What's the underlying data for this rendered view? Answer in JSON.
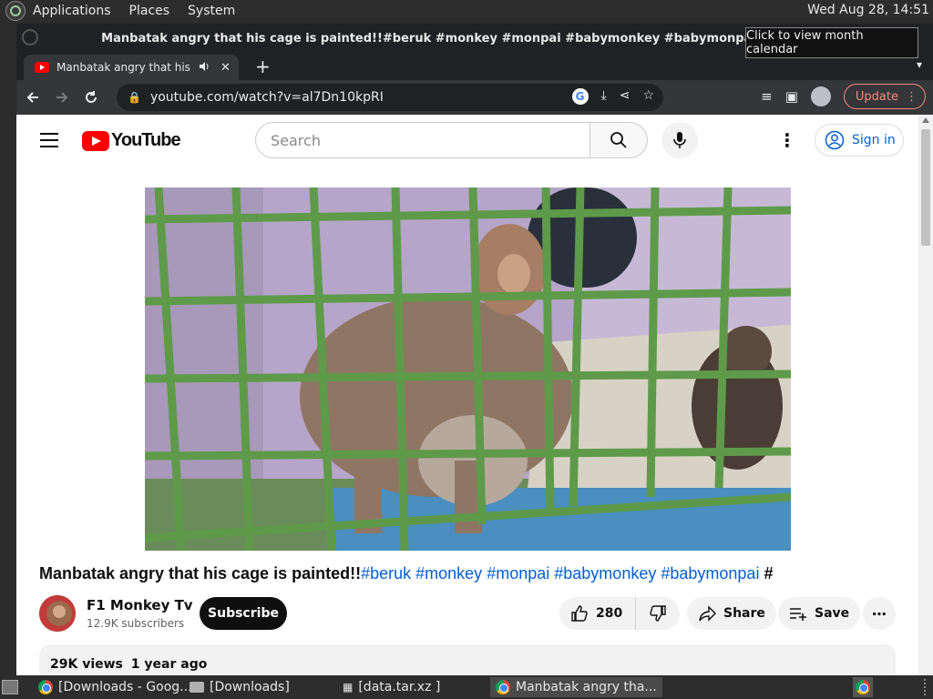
{
  "top_panel": {
    "menus": [
      "Applications",
      "Places",
      "System"
    ],
    "clock": "Wed Aug 28, 14:51"
  },
  "window": {
    "title": "Manbatak angry that his cage is painted!!#beruk #monkey #monpai #babymonkey #babymonpai # - YouTube -"
  },
  "tooltip": "Click to view month calendar",
  "tab": {
    "title": "Manbatak angry that his cage is painted!!#beruk #monkey #monpai #babymonkey #babymonpai #",
    "new_tab": "+"
  },
  "toolbar": {
    "url": "youtube.com/watch?v=al7Dn10kpRI",
    "update_label": "Update"
  },
  "youtube": {
    "logo_text": "YouTube",
    "search_placeholder": "Search",
    "sign_in": "Sign in"
  },
  "video": {
    "title_main": "Manbatak angry that his cage is painted!!",
    "tags": [
      "#beruk",
      "#monkey",
      "#monpai",
      "#babymonkey",
      "#babymonpai",
      "#"
    ],
    "channel_name": "F1 Monkey Tv",
    "subscribers": "12.9K subscribers",
    "subscribe_label": "Subscribe",
    "likes": "280",
    "share_label": "Share",
    "save_label": "Save",
    "views": "29K views",
    "age": "1 year ago"
  },
  "taskbar": {
    "tasks": [
      "[Downloads - Goog...",
      "[Downloads]",
      "[data.tar.xz ]",
      "Manbatak angry tha..."
    ]
  },
  "colors": {
    "yt_red": "#ff0000",
    "link_blue": "#065fd4",
    "update_accent": "#f28b82"
  }
}
